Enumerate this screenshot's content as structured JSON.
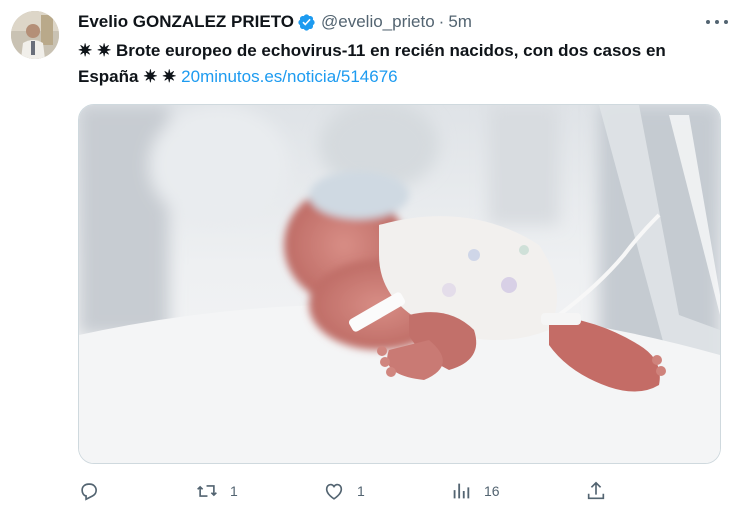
{
  "author": {
    "display_name": "Evelio GONZALEZ PRIETO",
    "handle": "@evelio_prieto",
    "separator": "·",
    "time": "5m"
  },
  "tweet": {
    "spark_prefix": "✷ ✷",
    "text_before_link": "Brote europeo de echovirus-11 en recién nacidos, con dos casos en España",
    "spark_suffix": "✷ ✷",
    "link": "20minutos.es/noticia/514676"
  },
  "actions": {
    "reply_count": "",
    "retweet_count": "1",
    "like_count": "1",
    "views_count": "16"
  },
  "colors": {
    "accent": "#1d9bf0",
    "secondary_text": "#536471",
    "primary_text": "#0f1419",
    "border": "#cfd9de"
  },
  "icons": [
    "verified-badge-icon",
    "more-icon",
    "reply-icon",
    "retweet-icon",
    "like-icon",
    "views-icon",
    "share-icon"
  ]
}
